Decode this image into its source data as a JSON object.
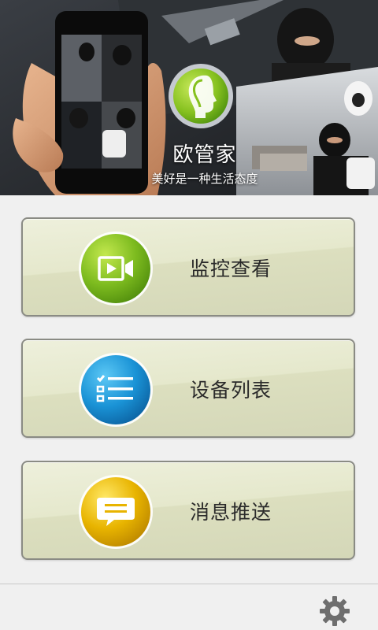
{
  "banner": {
    "brand_name": "欧管家",
    "slogan": "美好是一种生活态度"
  },
  "menu": {
    "items": [
      {
        "label": "监控查看",
        "icon": "video-camera-icon",
        "color": "#7dbb1f"
      },
      {
        "label": "设备列表",
        "icon": "checklist-icon",
        "color": "#1a93d6"
      },
      {
        "label": "消息推送",
        "icon": "chat-bubble-icon",
        "color": "#e8b400"
      }
    ]
  },
  "bottom_bar": {
    "settings_icon": "gear-icon"
  },
  "colors": {
    "button_bg": "#e2e5c7",
    "button_border": "#8a8b84",
    "page_bg": "#f0f0f0"
  }
}
